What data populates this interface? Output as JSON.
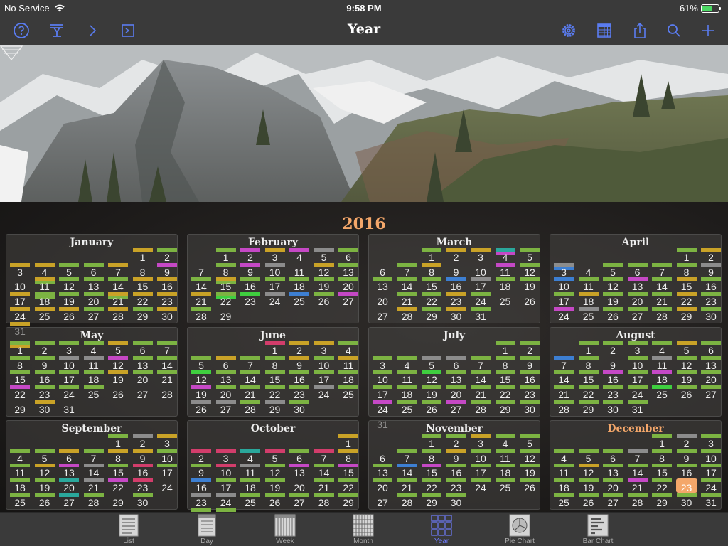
{
  "status_bar": {
    "carrier": "No Service",
    "time": "9:58 PM",
    "battery": "61%",
    "battery_level": 0.61
  },
  "nav": {
    "title": "Year",
    "left_icons": [
      "help-icon",
      "filter-icon",
      "forward-icon",
      "presentation-icon"
    ],
    "right_icons": [
      "settings-icon",
      "calendar-grid-icon",
      "share-icon",
      "search-icon",
      "add-icon"
    ]
  },
  "calendar": {
    "year": "2016",
    "current_month": "December",
    "today": {
      "month": 11,
      "day": 23
    },
    "months": [
      {
        "name": "January",
        "start": 5,
        "days": 31
      },
      {
        "name": "February",
        "start": 1,
        "days": 29
      },
      {
        "name": "March",
        "start": 2,
        "days": 31
      },
      {
        "name": "April",
        "start": 5,
        "days": 30
      },
      {
        "name": "May",
        "start": 0,
        "days": 31
      },
      {
        "name": "June",
        "start": 3,
        "days": 30
      },
      {
        "name": "July",
        "start": 5,
        "days": 31
      },
      {
        "name": "August",
        "start": 1,
        "days": 31
      },
      {
        "name": "September",
        "start": 4,
        "days": 30
      },
      {
        "name": "October",
        "start": 6,
        "days": 31
      },
      {
        "name": "November",
        "start": 2,
        "days": 30
      },
      {
        "name": "December",
        "start": 4,
        "days": 31
      }
    ]
  },
  "event_colors": {
    "g": "#7cb342",
    "y": "#c9a227",
    "m": "#c548c5",
    "p": "#d23d6b",
    "b": "#3d7fd2",
    "x": "#8c8c8c",
    "t": "#2aa79b",
    "k": "#3fcf3f"
  },
  "events": {
    "0": {
      "1": "y",
      "2": "g",
      "3": "y",
      "4": "y",
      "5": "g",
      "6": "g",
      "7": "y",
      "9": "m",
      "11": "yg",
      "12": "g",
      "13": "g",
      "14": "g",
      "15": "y",
      "16": "y",
      "17": "y",
      "18": "gg",
      "19": "g",
      "20": "g",
      "21": "yg",
      "22": "y",
      "23": "y",
      "24": "y",
      "25": "y",
      "26": "y",
      "27": "g",
      "28": "y",
      "29": "g",
      "30": "y",
      "31": "y"
    },
    "1": {
      "1": "g",
      "2": "m",
      "3": "y",
      "4": "m",
      "5": "x",
      "6": "g",
      "8": "g",
      "9": "m",
      "10": "x",
      "12": "y",
      "13": "g",
      "14": "g",
      "15": "yg",
      "16": "g",
      "17": "g",
      "18": "g",
      "19": "g",
      "20": "g",
      "21": "y",
      "22": "gk",
      "23": "k",
      "24": "x",
      "25": "b",
      "26": "g",
      "27": "m",
      "28": "g"
    },
    "2": {
      "1": "g",
      "2": "y",
      "3": "y",
      "4": "tm",
      "5": "g",
      "7": "g",
      "8": "y",
      "11": "m",
      "12": "g",
      "13": "g",
      "14": "g",
      "15": "g",
      "16": "b",
      "17": "x",
      "18": "g",
      "19": "g",
      "21": "g",
      "22": "g",
      "23": "y",
      "24": "g",
      "28": "y",
      "29": "g",
      "30": "y",
      "31": "g"
    },
    "3": {
      "1": "g",
      "2": "y",
      "3": "xb",
      "5": "g",
      "6": "g",
      "7": "g",
      "8": "g",
      "9": "x",
      "10": "b",
      "11": "g",
      "12": "g",
      "13": "m",
      "14": "g",
      "15": "y",
      "16": "g",
      "17": "g",
      "18": "y",
      "19": "g",
      "20": "g",
      "21": "g",
      "22": "y",
      "23": "g",
      "24": "m",
      "25": "x",
      "26": "g",
      "27": "g",
      "28": "g",
      "29": "y",
      "30": "g"
    },
    "4": {
      "1": "gy",
      "2": "g",
      "3": "g",
      "4": "g",
      "5": "y",
      "6": "g",
      "7": "g",
      "8": "g",
      "9": "g",
      "10": "x",
      "11": "x",
      "12": "m",
      "13": "g",
      "14": "g",
      "15": "g",
      "16": "g",
      "17": "g",
      "18": "g",
      "19": "y",
      "20": "g",
      "21": "g",
      "22": "m",
      "23": "g",
      "24": "g",
      "25": "g",
      "30": "y"
    },
    "5": {
      "1": "p",
      "2": "y",
      "3": "y",
      "4": "g",
      "5": "g",
      "6": "y",
      "7": "g",
      "8": "g",
      "9": "y",
      "10": "g",
      "11": "y",
      "12": "k",
      "13": "g",
      "14": "g",
      "15": "g",
      "16": "g",
      "17": "g",
      "18": "g",
      "19": "m",
      "20": "g",
      "21": "g",
      "22": "g",
      "23": "g",
      "24": "x",
      "25": "g",
      "26": "x",
      "27": "x",
      "28": "g",
      "29": "x",
      "30": "g"
    },
    "6": {
      "1": "g",
      "2": "g",
      "3": "g",
      "4": "g",
      "5": "x",
      "6": "x",
      "7": "g",
      "8": "g",
      "9": "g",
      "10": "g",
      "11": "g",
      "12": "k",
      "13": "g",
      "14": "g",
      "15": "g",
      "16": "g",
      "17": "g",
      "18": "g",
      "19": "g",
      "20": "g",
      "21": "g",
      "22": "g",
      "23": "g",
      "24": "m",
      "25": "g",
      "26": "g",
      "27": "m",
      "28": "g",
      "29": "g",
      "30": "g"
    },
    "7": {
      "1": "g",
      "2": "g",
      "3": "g",
      "4": "g",
      "5": "y",
      "6": "g",
      "7": "b",
      "8": "g",
      "10": "g",
      "11": "x",
      "12": "g",
      "13": "g",
      "14": "g",
      "15": "g",
      "16": "m",
      "17": "g",
      "18": "m",
      "19": "g",
      "20": "g",
      "21": "g",
      "22": "g",
      "23": "g",
      "24": "g",
      "25": "k",
      "26": "g",
      "27": "g",
      "28": "g",
      "29": "g",
      "30": "g",
      "31": "g"
    },
    "8": {
      "1": "g",
      "2": "x",
      "3": "y",
      "4": "g",
      "5": "g",
      "6": "y",
      "7": "g",
      "8": "y",
      "9": "y",
      "10": "g",
      "11": "g",
      "12": "y",
      "13": "m",
      "14": "x",
      "15": "g",
      "16": "p",
      "17": "g",
      "18": "g",
      "19": "g",
      "20": "t",
      "21": "x",
      "22": "m",
      "23": "p",
      "25": "g",
      "26": "g",
      "27": "t",
      "28": "g",
      "30": "g"
    },
    "9": {
      "1": "y",
      "2": "p",
      "3": "p",
      "4": "t",
      "5": "p",
      "6": "g",
      "7": "p",
      "8": "y",
      "9": "g",
      "10": "p",
      "11": "x",
      "12": "g",
      "13": "m",
      "14": "g",
      "15": "m",
      "16": "b",
      "17": "g",
      "18": "g",
      "19": "g",
      "21": "g",
      "22": "g",
      "23": "x",
      "24": "x",
      "25": "g",
      "26": "g",
      "27": "g",
      "28": "g",
      "29": "g",
      "30": "g",
      "31": "g"
    },
    "10": {
      "1": "g",
      "2": "g",
      "3": "y",
      "4": "g",
      "5": "g",
      "7": "g",
      "8": "g",
      "9": "y",
      "10": "g",
      "11": "g",
      "12": "g",
      "13": "g",
      "14": "b",
      "15": "m",
      "16": "g",
      "17": "g",
      "18": "g",
      "19": "g",
      "20": "g",
      "21": "g",
      "22": "g",
      "23": "g",
      "24": "g",
      "25": "g",
      "26": "g",
      "28": "g",
      "29": "g",
      "30": "g"
    },
    "11": {
      "1": "g",
      "2": "x",
      "3": "g",
      "4": "g",
      "5": "g",
      "6": "g",
      "7": "x",
      "8": "g",
      "9": "g",
      "10": "g",
      "11": "g",
      "12": "y",
      "13": "g",
      "14": "g",
      "15": "g",
      "16": "g",
      "17": "g",
      "18": "g",
      "19": "g",
      "20": "g",
      "21": "m",
      "22": "g",
      "24": "g",
      "25": "g",
      "26": "g",
      "27": "g",
      "28": "g",
      "29": "g",
      "30": "g",
      "31": "g"
    }
  },
  "tabs": [
    {
      "label": "List",
      "icon": "list-icon",
      "active": false
    },
    {
      "label": "Day",
      "icon": "day-icon",
      "active": false
    },
    {
      "label": "Week",
      "icon": "week-icon",
      "active": false
    },
    {
      "label": "Month",
      "icon": "month-icon",
      "active": false
    },
    {
      "label": "Year",
      "icon": "year-icon",
      "active": true
    },
    {
      "label": "Pie Chart",
      "icon": "pie-chart-icon",
      "active": false
    },
    {
      "label": "Bar Chart",
      "icon": "bar-chart-icon",
      "active": false
    }
  ]
}
